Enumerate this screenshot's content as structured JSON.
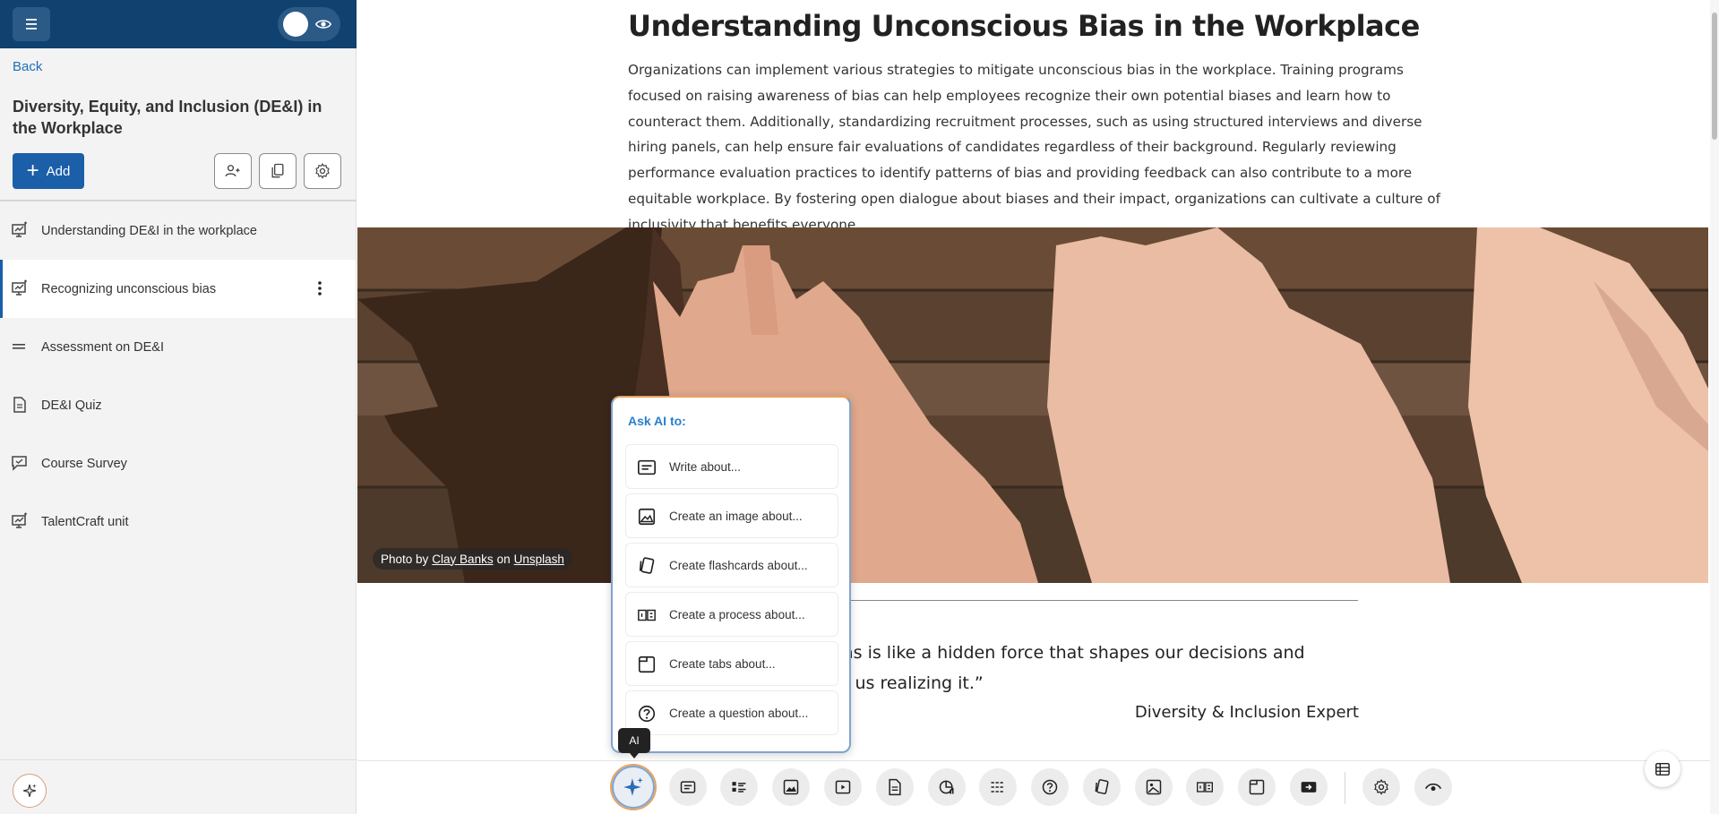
{
  "sidebar": {
    "back_label": "Back",
    "course_title": "Diversity, Equity, and Inclusion (DE&I) in the Workplace",
    "add_label": "Add",
    "items": [
      {
        "label": "Understanding DE&I in the workplace",
        "icon": "presentation-icon"
      },
      {
        "label": "Recognizing unconscious bias",
        "icon": "presentation-icon"
      },
      {
        "label": "Assessment on DE&I",
        "icon": "assessment-icon"
      },
      {
        "label": "DE&I Quiz",
        "icon": "document-icon"
      },
      {
        "label": "Course Survey",
        "icon": "survey-icon"
      },
      {
        "label": "TalentCraft unit",
        "icon": "presentation-icon"
      }
    ]
  },
  "main": {
    "title": "Understanding Unconscious Bias in the Workplace",
    "body": "Organizations can implement various strategies to mitigate unconscious bias in the workplace. Training programs focused on raising awareness of bias can help employees recognize their own potential biases and learn how to counteract them. Additionally, standardizing recruitment processes, such as using structured interviews and diverse hiring panels, can help ensure fair evaluations of candidates regardless of their background. Regularly reviewing performance evaluation practices to identify patterns of bias and providing feedback can also contribute to a more equitable workplace. By fostering open dialogue about biases and their impact, organizations can cultivate a culture of inclusivity that benefits everyone.",
    "credit": {
      "prefix": "Photo by",
      "author": "Clay Banks",
      "mid": "on",
      "site": "Unsplash"
    },
    "quote_line1": "as is like a hidden force that shapes our decisions and",
    "quote_line2": "t us realizing it.”",
    "quote_author": "Diversity & Inclusion Expert"
  },
  "ai_popup": {
    "title": "Ask AI to:",
    "options": [
      {
        "label": "Write about...",
        "icon": "text-icon"
      },
      {
        "label": "Create an image about...",
        "icon": "image-icon"
      },
      {
        "label": "Create flashcards about...",
        "icon": "flashcards-icon"
      },
      {
        "label": "Create a process about...",
        "icon": "process-icon"
      },
      {
        "label": "Create tabs about...",
        "icon": "tabs-icon"
      },
      {
        "label": "Create a question about...",
        "icon": "question-icon"
      }
    ],
    "tooltip": "AI"
  },
  "colors": {
    "header": "#11416e",
    "accent": "#1a5fa8",
    "link": "#1f6fb5",
    "ai_title": "#2a7fcf"
  }
}
